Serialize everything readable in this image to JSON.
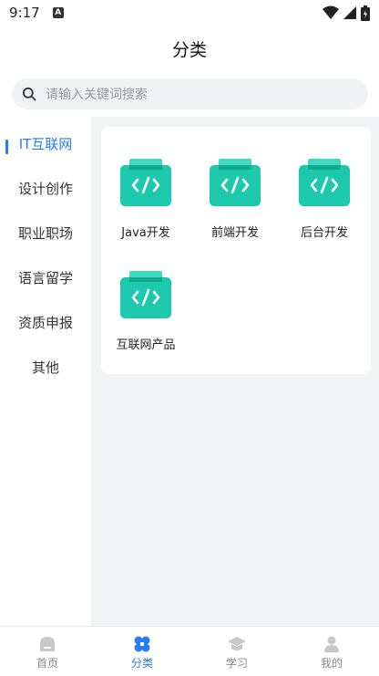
{
  "status_bar": {
    "time": "9:17",
    "badge": "A",
    "icons": [
      "wifi-icon",
      "signal-icon",
      "battery-icon"
    ]
  },
  "header": {
    "title": "分类"
  },
  "search": {
    "placeholder": "请输入关键词搜索",
    "icon": "search-icon"
  },
  "sidebar": {
    "active_index": 0,
    "items": [
      {
        "label": "IT互联网"
      },
      {
        "label": "设计创作"
      },
      {
        "label": "职业职场"
      },
      {
        "label": "语言留学"
      },
      {
        "label": "资质申报"
      },
      {
        "label": "其他"
      }
    ]
  },
  "categories": [
    {
      "label": "Java开发",
      "icon": "code-folder-icon"
    },
    {
      "label": "前端开发",
      "icon": "code-folder-icon"
    },
    {
      "label": "后台开发",
      "icon": "code-folder-icon"
    },
    {
      "label": "互联网产品",
      "icon": "code-folder-icon"
    }
  ],
  "tab_bar": {
    "active_index": 1,
    "tabs": [
      {
        "label": "首页",
        "icon": "home-icon"
      },
      {
        "label": "分类",
        "icon": "category-icon"
      },
      {
        "label": "学习",
        "icon": "graduation-cap-icon"
      },
      {
        "label": "我的",
        "icon": "user-icon"
      }
    ]
  },
  "colors": {
    "accent": "#2b7cf0",
    "icon_teal": "#1dc9ac",
    "icon_teal_dark": "#0fa98e",
    "content_bg": "#f2f3f5"
  }
}
